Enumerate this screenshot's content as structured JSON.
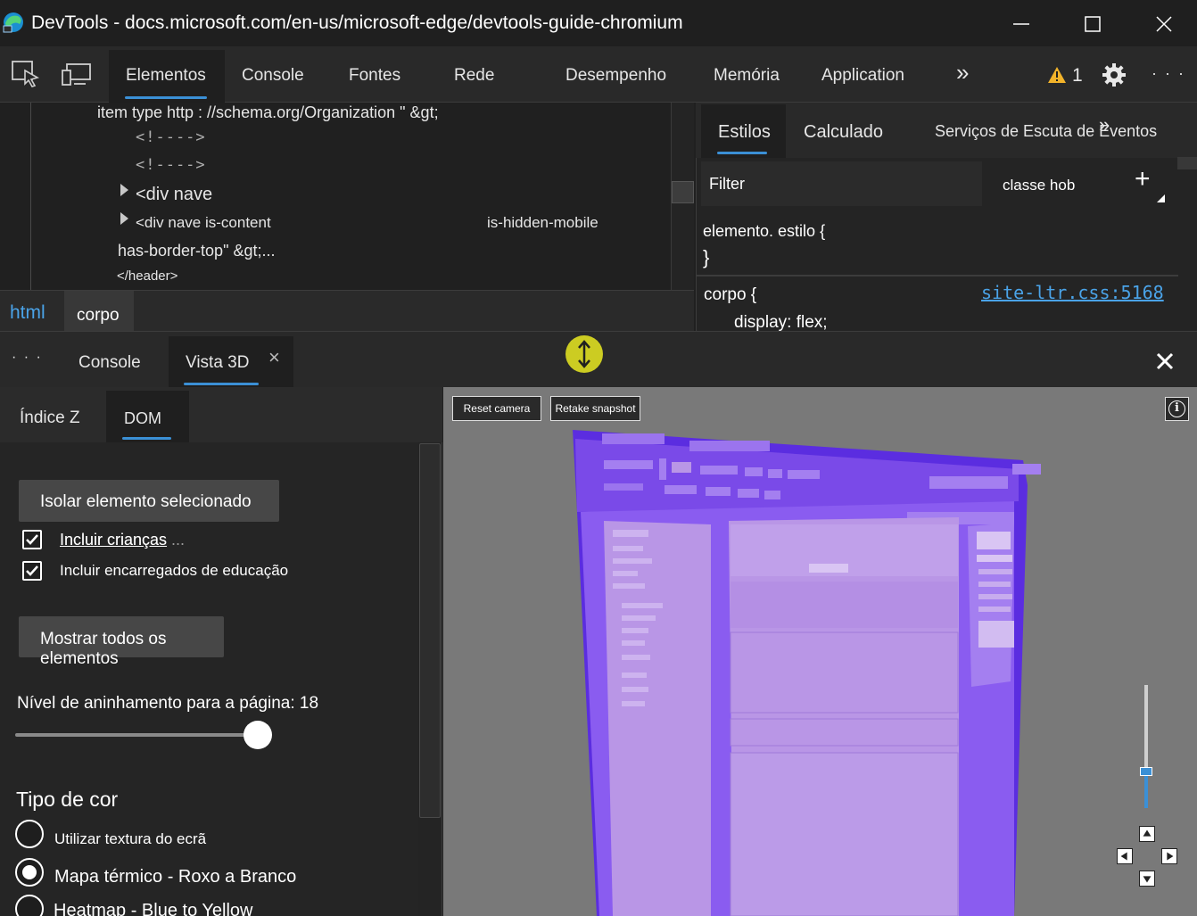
{
  "window": {
    "title": "DevTools - docs.microsoft.com/en-us/microsoft-edge/devtools-guide-chromium"
  },
  "toolbar": {
    "tabs": [
      "Elementos",
      "Console",
      "Fontes",
      "Rede",
      "Desempenho",
      "Memória",
      "Application"
    ],
    "active_tab": "Elementos",
    "more_tabs": "»",
    "warning_count": "1",
    "more_options": "· · ·"
  },
  "dom_tree": {
    "lines": [
      "item type http : //schema.org/Organization \" &gt;",
      "<!---->",
      "<!---->",
      "<div nave",
      "<div nave is-content",
      "is-hidden-mobile",
      "has-border-top\" &gt;...",
      "</header>"
    ]
  },
  "breadcrumb": {
    "items": [
      "html",
      "corpo"
    ]
  },
  "styles": {
    "tabs": [
      "Estilos",
      "Calculado",
      "Serviços de Escuta de Eventos"
    ],
    "active_tab": "Estilos",
    "more_tabs": "»",
    "filter_placeholder": "Filter",
    "hov_cls": "classe hob",
    "add_rule": "+",
    "element_style_selector": "elemento. estilo {",
    "element_style_close": "}",
    "rule_selector": "corpo {",
    "rule_source": "site-ltr.css:5168",
    "rule_property": "display: flex;"
  },
  "drawer": {
    "more": "· · ·",
    "tabs": [
      "Console",
      "Vista 3D"
    ],
    "active_tab": "Vista 3D",
    "close_tab": "×"
  },
  "view3d_panel": {
    "tabs": [
      "Índice Z",
      "DOM"
    ],
    "active_tab": "DOM",
    "isolate_button": "Isolar elemento selecionado",
    "include_children": "Incluir crianças",
    "include_children_overlap": "Incluir crianças ...",
    "include_parents": "Incluir encarregados de educação",
    "show_all_button": "Mostrar todos os elementos",
    "nesting_label": "Nível de aninhamento para a página: 18",
    "nesting_fraction": 1.0,
    "color_type_heading": "Tipo de cor",
    "color_options": [
      "Utilizar textura do ecrã",
      "Mapa térmico - Roxo a Branco",
      "Heatmap - Blue to Yellow"
    ],
    "selected_color_option": "Mapa térmico - Roxo a Branco"
  },
  "canvas3d": {
    "reset_camera": "Reset camera",
    "retake_snapshot": "Retake snapshot",
    "info": "i",
    "zoom_fraction": 0.3,
    "colors": {
      "background": "#797979",
      "deep_purple": "#5b2de0",
      "mid_purple": "#8a5cf0",
      "light_purple": "#b996e6",
      "accent": "#3b90d6"
    }
  }
}
